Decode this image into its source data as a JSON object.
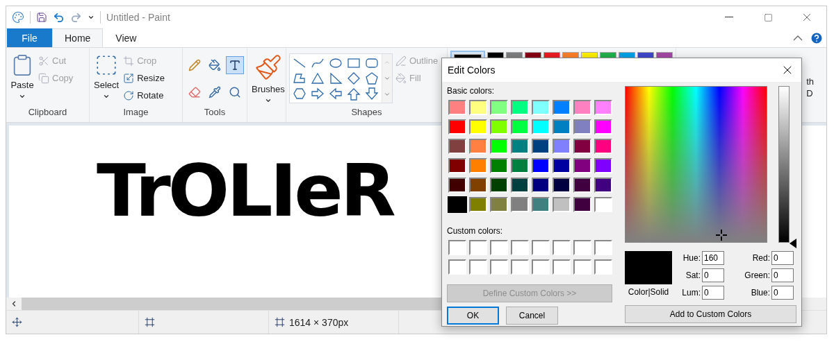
{
  "title_bar": {
    "title": "Untitled - Paint"
  },
  "tabs": [
    {
      "label": "File",
      "kind": "file",
      "selected": false
    },
    {
      "label": "Home",
      "kind": "tab",
      "selected": true
    },
    {
      "label": "View",
      "kind": "tab",
      "selected": false
    }
  ],
  "ribbon": {
    "groups": [
      {
        "label": "Clipboard",
        "kind": "clipboard",
        "big": {
          "label": "Paste"
        },
        "small": [
          {
            "label": "Cut",
            "disabled": true
          },
          {
            "label": "Copy",
            "disabled": true
          }
        ]
      },
      {
        "label": "Image",
        "kind": "image",
        "big": {
          "label": "Select"
        },
        "small": [
          {
            "label": "Crop",
            "disabled": true
          },
          {
            "label": "Resize",
            "disabled": false
          },
          {
            "label": "Rotate",
            "disabled": false
          }
        ]
      },
      {
        "label": "Tools",
        "kind": "tools",
        "tools": [
          {
            "selected": false
          },
          {
            "selected": false
          },
          {
            "selected": true
          },
          {
            "selected": false
          },
          {
            "selected": false
          },
          {
            "selected": false
          }
        ]
      },
      {
        "kind": "brushes",
        "big": {
          "label": "Brushes"
        }
      },
      {
        "label": "Shapes",
        "kind": "shapes",
        "small": [
          {
            "label": "Outline",
            "disabled": true
          },
          {
            "label": "Fill",
            "disabled": true
          }
        ]
      }
    ],
    "current_color": {
      "color": "#000000",
      "selected": true
    },
    "palette": [
      {
        "color": "#000000"
      },
      {
        "color": "#7f7f7f"
      },
      {
        "color": "#880015"
      },
      {
        "color": "#ed1c24"
      },
      {
        "color": "#ff7f27"
      },
      {
        "color": "#fff200"
      },
      {
        "color": "#22b14c"
      },
      {
        "color": "#00a2e8"
      },
      {
        "color": "#3f48cc"
      },
      {
        "color": "#a349a4"
      }
    ],
    "paint3d": {
      "lines": [
        "th",
        "D"
      ]
    }
  },
  "canvas": {
    "text": "TrOLIeR"
  },
  "status_bar": {
    "size": "1614 × 370px"
  },
  "dialog": {
    "title": "Edit Colors",
    "basic_label": "Basic colors:",
    "basic_colors": [
      {
        "color": "#ff8080",
        "selected": false
      },
      {
        "color": "#ffff80",
        "selected": false
      },
      {
        "color": "#80ff80",
        "selected": false
      },
      {
        "color": "#00ff80",
        "selected": false
      },
      {
        "color": "#80ffff",
        "selected": false
      },
      {
        "color": "#0080ff",
        "selected": false
      },
      {
        "color": "#ff80c0",
        "selected": false
      },
      {
        "color": "#ff80ff",
        "selected": false
      },
      {
        "color": "#ff0000",
        "selected": false
      },
      {
        "color": "#ffff00",
        "selected": false
      },
      {
        "color": "#80ff00",
        "selected": false
      },
      {
        "color": "#00ff40",
        "selected": false
      },
      {
        "color": "#00ffff",
        "selected": false
      },
      {
        "color": "#0080c0",
        "selected": false
      },
      {
        "color": "#8080c0",
        "selected": false
      },
      {
        "color": "#ff00ff",
        "selected": false
      },
      {
        "color": "#804040",
        "selected": false
      },
      {
        "color": "#ff8040",
        "selected": false
      },
      {
        "color": "#00ff00",
        "selected": false
      },
      {
        "color": "#008080",
        "selected": false
      },
      {
        "color": "#004080",
        "selected": false
      },
      {
        "color": "#8080ff",
        "selected": false
      },
      {
        "color": "#800040",
        "selected": false
      },
      {
        "color": "#ff0080",
        "selected": false
      },
      {
        "color": "#800000",
        "selected": false
      },
      {
        "color": "#ff8000",
        "selected": false
      },
      {
        "color": "#008000",
        "selected": false
      },
      {
        "color": "#008040",
        "selected": false
      },
      {
        "color": "#0000ff",
        "selected": false
      },
      {
        "color": "#0000a0",
        "selected": false
      },
      {
        "color": "#800080",
        "selected": false
      },
      {
        "color": "#8000ff",
        "selected": false
      },
      {
        "color": "#400000",
        "selected": false
      },
      {
        "color": "#804000",
        "selected": false
      },
      {
        "color": "#004000",
        "selected": false
      },
      {
        "color": "#004040",
        "selected": false
      },
      {
        "color": "#000080",
        "selected": false
      },
      {
        "color": "#000040",
        "selected": false
      },
      {
        "color": "#400040",
        "selected": false
      },
      {
        "color": "#400080",
        "selected": false
      },
      {
        "color": "#000000",
        "selected": true
      },
      {
        "color": "#808000",
        "selected": false
      },
      {
        "color": "#808040",
        "selected": false
      },
      {
        "color": "#808080",
        "selected": false
      },
      {
        "color": "#408080",
        "selected": false
      },
      {
        "color": "#c0c0c0",
        "selected": false
      },
      {
        "color": "#400040",
        "selected": false
      },
      {
        "color": "#ffffff",
        "selected": false
      }
    ],
    "custom_label": "Custom colors:",
    "custom_colors": [
      {
        "color": "#ffffff"
      },
      {
        "color": "#ffffff"
      },
      {
        "color": "#ffffff"
      },
      {
        "color": "#ffffff"
      },
      {
        "color": "#ffffff"
      },
      {
        "color": "#ffffff"
      },
      {
        "color": "#ffffff"
      },
      {
        "color": "#ffffff"
      },
      {
        "color": "#ffffff"
      },
      {
        "color": "#ffffff"
      },
      {
        "color": "#ffffff"
      },
      {
        "color": "#ffffff"
      },
      {
        "color": "#ffffff"
      },
      {
        "color": "#ffffff"
      },
      {
        "color": "#ffffff"
      },
      {
        "color": "#ffffff"
      }
    ],
    "define_button": {
      "label": "Define Custom Colors >>",
      "disabled": true
    },
    "ok_button": {
      "label": "OK",
      "selected": true
    },
    "cancel_button": {
      "label": "Cancel"
    },
    "preview": {
      "label": "Color|Solid",
      "color": "#000000"
    },
    "hsl_fields": [
      {
        "label": "Hue:",
        "value": "160"
      },
      {
        "label": "Sat:",
        "value": "0"
      },
      {
        "label": "Lum:",
        "value": "0"
      }
    ],
    "rgb_fields": [
      {
        "label": "Red:",
        "value": "0"
      },
      {
        "label": "Green:",
        "value": "0"
      },
      {
        "label": "Blue:",
        "value": "0"
      }
    ],
    "luminance": {
      "level": 0
    },
    "add_button": {
      "label": "Add to Custom Colors"
    }
  }
}
